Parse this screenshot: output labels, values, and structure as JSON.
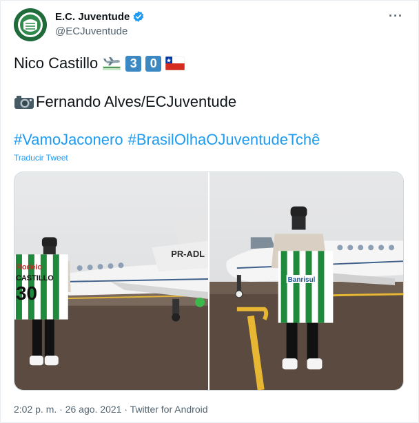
{
  "author": {
    "display_name": "E.C. Juventude",
    "handle": "@ECJuventude",
    "verified": true
  },
  "tweet": {
    "line1_text": "Nico Castillo",
    "line1_keycaps": [
      "3",
      "0"
    ],
    "line2_text": "Fernando Alves/ECJuventude",
    "hashtags": [
      "#VamoJaconero",
      "#BrasilOlhaOJuventudeTchê"
    ],
    "translate_label": "Traducir Tweet"
  },
  "photos": [
    {
      "jersey_name": "CASTILLO",
      "jersey_number": "30",
      "plane_reg": "PR-ADL"
    },
    {
      "jersey_sponsor": "Banrisul"
    }
  ],
  "footer": {
    "time": "2:02 p. m.",
    "separator": "·",
    "date": "26 ago. 2021",
    "client": "Twitter for Android"
  },
  "colors": {
    "link": "#1d9bf0",
    "club_green": "#1f6b3a",
    "keycap_blue": "#3b88c3"
  }
}
